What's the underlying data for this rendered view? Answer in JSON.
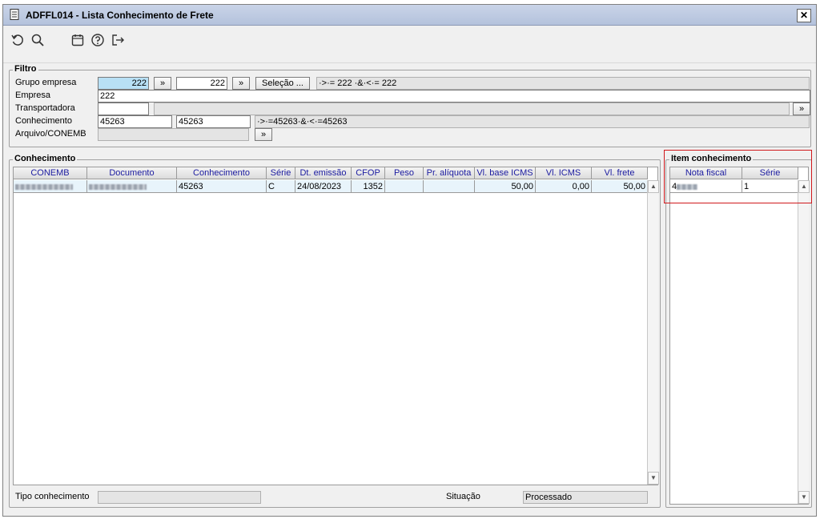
{
  "window": {
    "title": "ADFFL014 - Lista Conhecimento de Frete",
    "close_label": "✕"
  },
  "toolbar": {
    "icons": [
      "refresh-icon",
      "search-icon",
      "calendar-icon",
      "help-icon",
      "exit-icon"
    ]
  },
  "filtro": {
    "legend": "Filtro",
    "grupo_empresa": {
      "label": "Grupo empresa",
      "from": "222",
      "to": "222",
      "selecao_label": "Seleção ...",
      "expression": "·>·= 222 ·&·<·= 222"
    },
    "empresa": {
      "label": "Empresa",
      "value": "222"
    },
    "transportadora": {
      "label": "Transportadora",
      "value": "",
      "name": ""
    },
    "conhecimento": {
      "label": "Conhecimento",
      "from": "45263",
      "to": "45263",
      "expression": "·>·=45263·&·<·=45263"
    },
    "arquivo_conemb": {
      "label": "Arquivo/CONEMB",
      "value": ""
    },
    "lookup_label": "»"
  },
  "conhecimento": {
    "legend": "Conhecimento",
    "columns": [
      "CONEMB",
      "Documento",
      "Conhecimento",
      "Série",
      "Dt. emissão",
      "CFOP",
      "Peso",
      "Pr. alíquota",
      "Vl. base ICMS",
      "Vl. ICMS",
      "Vl. frete"
    ],
    "rows": [
      {
        "conemb": "",
        "documento": "",
        "conhecimento": "45263",
        "serie": "C",
        "dt_emissao": "24/08/2023",
        "cfop": "1352",
        "peso": "",
        "pr_aliquota": "",
        "vl_base_icms": "50,00",
        "vl_icms": "0,00",
        "vl_frete": "50,00"
      }
    ],
    "tipo_label": "Tipo conhecimento",
    "tipo_value": "",
    "situacao_label": "Situação",
    "situacao_value": "Processado"
  },
  "item": {
    "legend": "Item conhecimento",
    "columns": [
      "Nota fiscal",
      "Série"
    ],
    "rows": [
      {
        "nota_fiscal": "4",
        "serie": "1"
      }
    ]
  },
  "colors": {
    "highlight": "#d0181c",
    "header_text": "#1a1aa0",
    "row_bg": "#e8f4fb"
  }
}
